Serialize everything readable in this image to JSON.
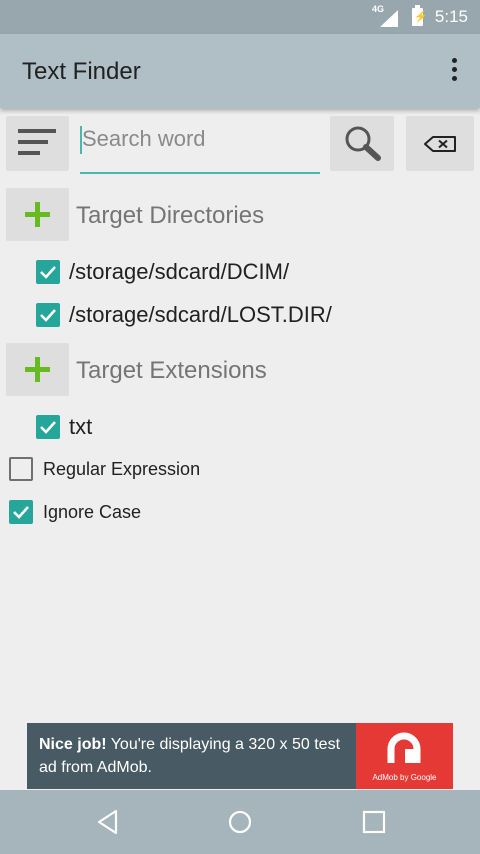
{
  "status_bar": {
    "network": "4G",
    "time": "5:15"
  },
  "app_bar": {
    "title": "Text Finder"
  },
  "search": {
    "placeholder": "Search word",
    "value": ""
  },
  "sections": {
    "directories_label": "Target Directories",
    "directories": [
      {
        "path": "/storage/sdcard/DCIM/",
        "checked": true
      },
      {
        "path": "/storage/sdcard/LOST.DIR/",
        "checked": true
      }
    ],
    "extensions_label": "Target Extensions",
    "extensions": [
      {
        "ext": "txt",
        "checked": true
      }
    ]
  },
  "options": {
    "regex_label": "Regular Expression",
    "regex_checked": false,
    "ignore_case_label": "Ignore Case",
    "ignore_case_checked": true
  },
  "ad": {
    "bold": "Nice job!",
    "text": " You're displaying a 320 x 50 test ad from AdMob.",
    "caption": "AdMob by Google"
  },
  "colors": {
    "accent": "#26a69a",
    "plus": "#66bb22",
    "app_bar": "#b0bec5",
    "ad_logo": "#e53935"
  }
}
